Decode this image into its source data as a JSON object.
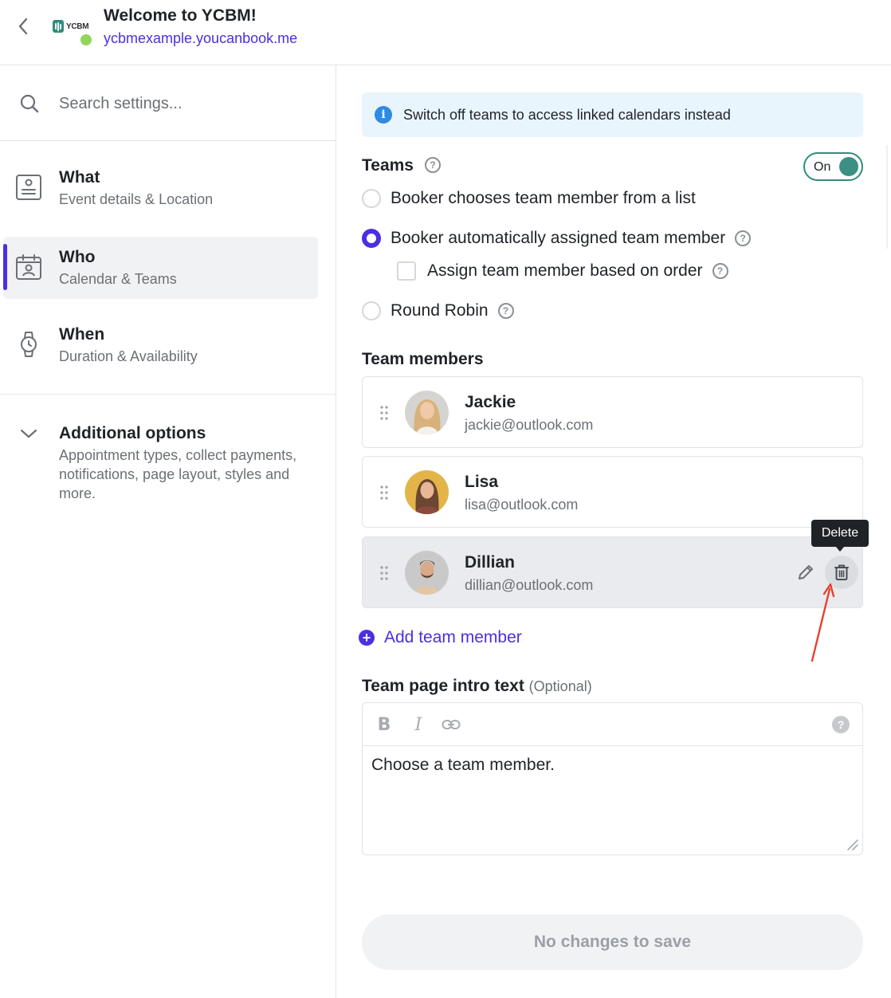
{
  "header": {
    "title": "Welcome to YCBM!",
    "url": "ycbmexample.youcanbook.me",
    "logo_text": "YCBM",
    "status_color": "#8fd65b"
  },
  "sidebar": {
    "search_placeholder": "Search settings...",
    "items": [
      {
        "icon": "id-card-icon",
        "title": "What",
        "subtitle": "Event details & Location",
        "active": false
      },
      {
        "icon": "calendar-user-icon",
        "title": "Who",
        "subtitle": "Calendar & Teams",
        "active": true
      },
      {
        "icon": "watch-icon",
        "title": "When",
        "subtitle": "Duration & Availability",
        "active": false
      }
    ],
    "additional": {
      "title": "Additional options",
      "subtitle": "Appointment types, collect payments, notifications, page layout, styles and more."
    }
  },
  "main": {
    "banner_text": "Switch off teams to access linked calendars instead",
    "teams_label": "Teams",
    "toggle_label": "On",
    "options": [
      {
        "label": "Booker chooses team member from a list",
        "checked": false
      },
      {
        "label": "Booker automatically assigned team member",
        "checked": true
      },
      {
        "label": "Round Robin",
        "checked": false
      }
    ],
    "sub_option": {
      "label": "Assign team member based on order",
      "checked": false
    },
    "members_label": "Team members",
    "members": [
      {
        "name": "Jackie",
        "email": "jackie@outlook.com"
      },
      {
        "name": "Lisa",
        "email": "lisa@outlook.com"
      },
      {
        "name": "Dillian",
        "email": "dillian@outlook.com"
      }
    ],
    "tooltip": "Delete",
    "add_member_label": "Add team member",
    "intro_label": "Team page intro text",
    "intro_optional": "(Optional)",
    "intro_text": "Choose a team member.",
    "save_label": "No changes to save"
  },
  "colors": {
    "accent": "#4b2fe0",
    "toggle": "#2f8d7a",
    "arrow": "#e8402f",
    "info": "#2d8ae5"
  }
}
